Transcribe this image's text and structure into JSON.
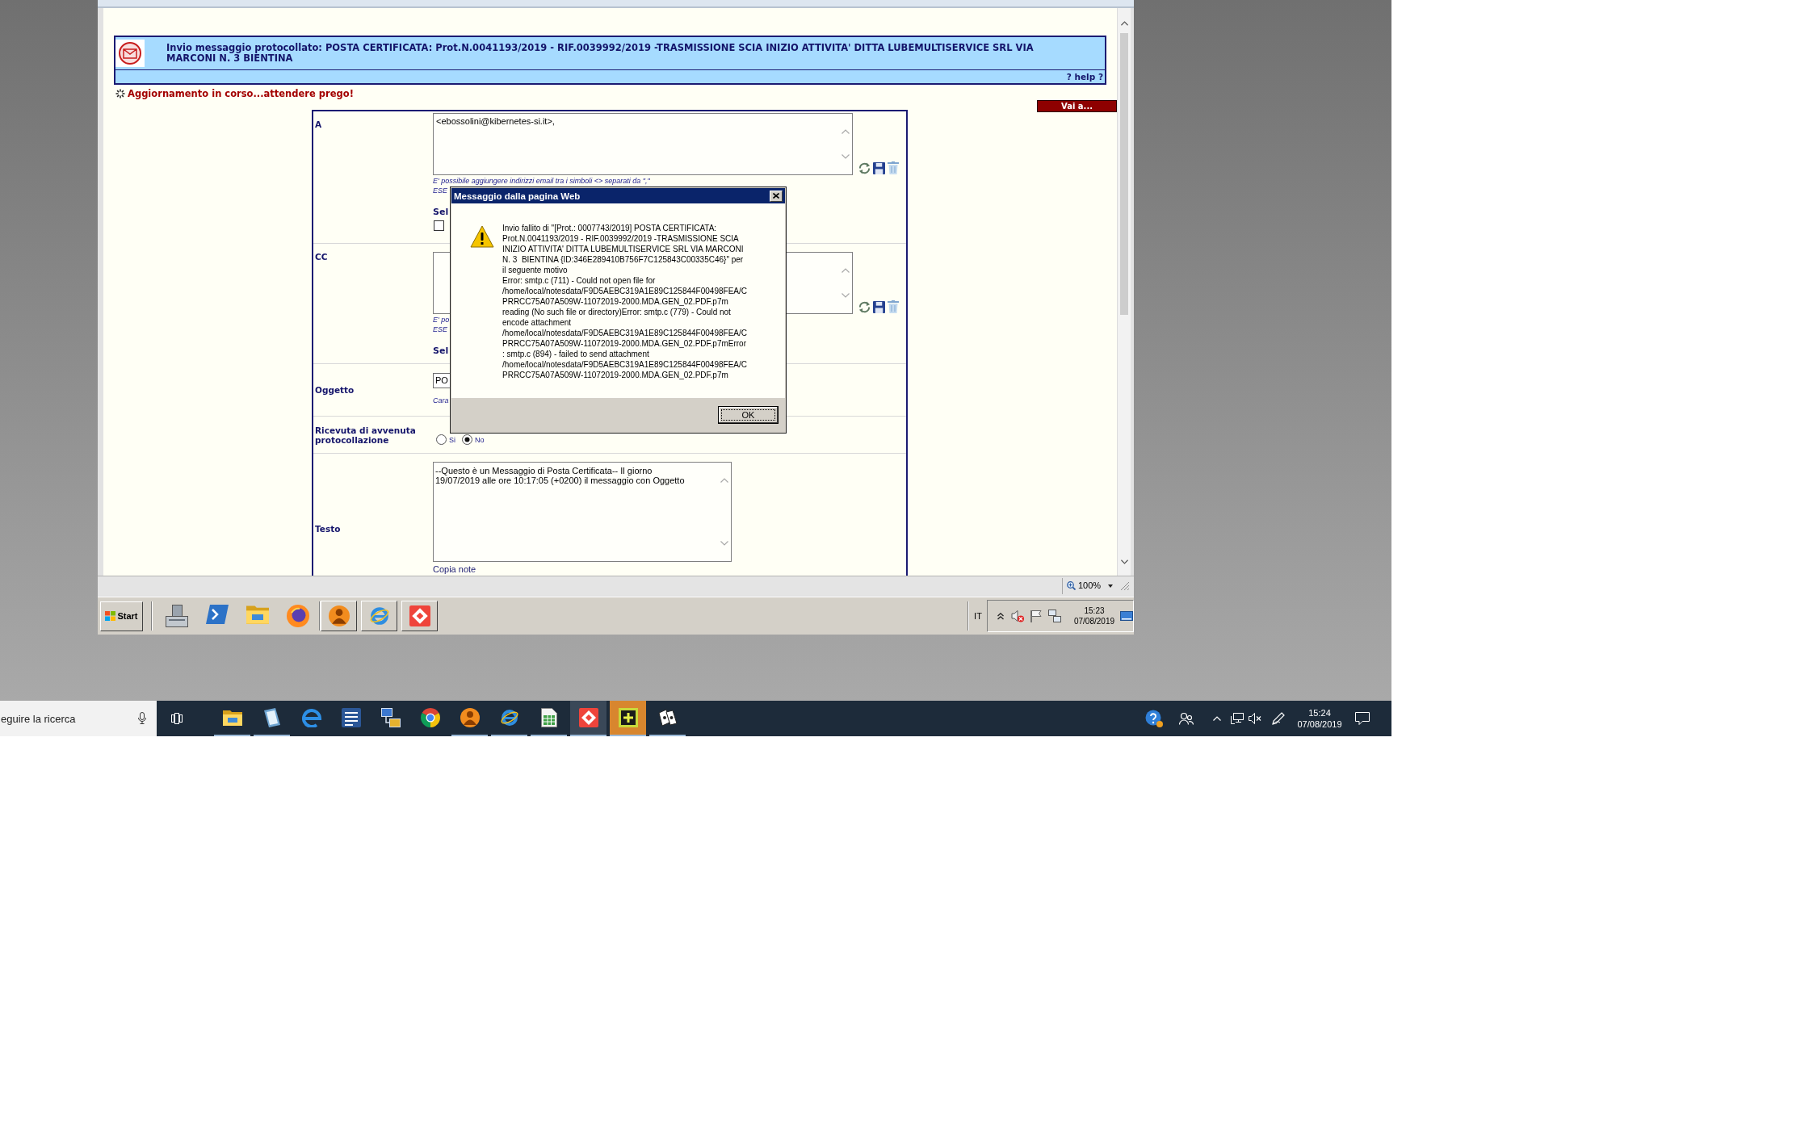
{
  "browser": {
    "page": {
      "header": {
        "title": "Invio messaggio protocollato: POSTA CERTIFICATA: Prot.N.0041193/2019 - RIF.0039992/2019 -TRASMISSIONE SCIA INIZIO ATTIVITA' DITTA LUBEMULTISERVICE SRL VIA MARCONI N. 3 BIENTINA",
        "help_link": "? help ?"
      },
      "status_message": "Aggiornamento in corso...attendere prego!",
      "goto_button": "Vai a...",
      "form_rows": [
        {
          "kind": "recipients",
          "label": "A",
          "value": "<ebossolini@kibernetes-si.it>,",
          "hint_lines": [
            "E' possibile aggiungere indirizzi email tra i simboli <> separati da \",\"",
            "ESE"
          ],
          "select_label": "Sel",
          "checked": false
        },
        {
          "kind": "recipients",
          "label": "CC",
          "hint_lines": [
            "E' po",
            "ESE"
          ],
          "select_label": "Sel"
        },
        {
          "kind": "input",
          "label": "Oggetto",
          "value": "PO",
          "hint": "Cara"
        },
        {
          "kind": "radio",
          "label": "Ricevuta di avvenuta protocollazione",
          "options": [
            {
              "label": "Si",
              "selected": false
            },
            {
              "label": "No",
              "selected": true
            }
          ]
        },
        {
          "kind": "textarea",
          "label": "Testo",
          "value_lines": [
            "--Questo è un Messaggio di Posta Certificata-- Il giorno",
            "19/07/2019 alle ore 10:17:05 (+0200) il messaggio con Oggetto"
          ],
          "link": "Copia note"
        }
      ]
    },
    "status_bar": {
      "zoom": "100%"
    }
  },
  "dialog": {
    "title": "Messaggio dalla pagina Web",
    "message_lines": [
      "Invio fallito di \"[Prot.: 0007743/2019] POSTA CERTIFICATA:",
      "Prot.N.0041193/2019 - RIF.0039992/2019 -TRASMISSIONE SCIA",
      "INIZIO ATTIVITA' DITTA LUBEMULTISERVICE SRL VIA MARCONI",
      "N. 3  BIENTINA {ID:346E289410B756F7C125843C00335C46}\" per",
      "il seguente motivo",
      "Error: smtp.c (711) - Could not open file for",
      "/home/local/notesdata/F9D5AEBC319A1E89C125844F00498FEA/C",
      "PRRCC75A07A509W-11072019-2000.MDA.GEN_02.PDF.p7m",
      "reading (No such file or directory)Error: smtp.c (779) - Could not",
      "encode attachment",
      "/home/local/notesdata/F9D5AEBC319A1E89C125844F00498FEA/C",
      "PRRCC75A07A509W-11072019-2000.MDA.GEN_02.PDF.p7mError",
      ": smtp.c (894) - failed to send attachment",
      "/home/local/notesdata/F9D5AEBC319A1E89C125844F00498FEA/C",
      "PRRCC75A07A509W-11072019-2000.MDA.GEN_02.PDF.p7m"
    ],
    "button": "OK"
  },
  "remote_taskbar": {
    "start_button": "Start",
    "language": "IT",
    "clock": {
      "time": "15:23",
      "date": "07/08/2019"
    }
  },
  "windows_taskbar": {
    "search": {
      "placeholder": "eguire la ricerca"
    },
    "apps": [
      {
        "kind": "folder",
        "running": true,
        "selected": false,
        "flashing": false
      },
      {
        "kind": "notebook",
        "running": true,
        "selected": false,
        "flashing": false
      },
      {
        "kind": "swirl",
        "running": false,
        "selected": false,
        "flashing": false
      },
      {
        "kind": "document",
        "running": false,
        "selected": false,
        "flashing": false
      },
      {
        "kind": "computers",
        "running": false,
        "selected": false,
        "flashing": false
      },
      {
        "kind": "ring",
        "running": false,
        "selected": false,
        "flashing": false
      },
      {
        "kind": "person",
        "running": true,
        "selected": false,
        "flashing": false
      },
      {
        "kind": "orbit",
        "running": true,
        "selected": false,
        "flashing": false
      },
      {
        "kind": "sheet",
        "running": true,
        "selected": false,
        "flashing": false
      },
      {
        "kind": "diamond",
        "running": true,
        "selected": true,
        "flashing": false
      },
      {
        "kind": "plus",
        "running": true,
        "selected": false,
        "flashing": true
      },
      {
        "kind": "cards",
        "running": true,
        "selected": false,
        "flashing": false
      }
    ],
    "clock": {
      "time": "15:24",
      "date": "07/08/2019"
    }
  }
}
